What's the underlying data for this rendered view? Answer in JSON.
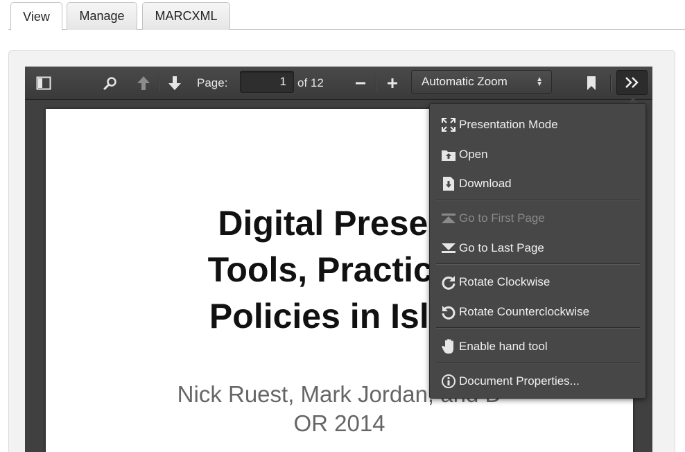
{
  "tabs": [
    {
      "label": "View",
      "active": true
    },
    {
      "label": "Manage",
      "active": false
    },
    {
      "label": "MARCXML",
      "active": false
    }
  ],
  "toolbar": {
    "page_label": "Page:",
    "page_value": "1",
    "page_of": "of 12",
    "zoom_label": "Automatic Zoom",
    "icons": [
      "sidebar-toggle-icon",
      "search-icon",
      "previous-page-icon",
      "next-page-icon",
      "zoom-out-icon",
      "zoom-in-icon",
      "bookmark-icon",
      "tools-icon"
    ]
  },
  "document": {
    "title_lines": [
      "Digital Preserv",
      "Tools, Practices",
      "Policies in Islan"
    ],
    "authors_line": "Nick Ruest, Mark Jordan, and D",
    "conference": "OR 2014"
  },
  "menu": {
    "presentation_mode": "Presentation Mode",
    "open": "Open",
    "download": "Download",
    "first_page": "Go to First Page",
    "last_page": "Go to Last Page",
    "rotate_cw": "Rotate Clockwise",
    "rotate_ccw": "Rotate Counterclockwise",
    "hand_tool": "Enable hand tool",
    "document_properties": "Document Properties..."
  },
  "colors": {
    "toolbar_bg": "#404040",
    "menu_bg": "#474747",
    "disabled_text": "#8a8a8a"
  }
}
